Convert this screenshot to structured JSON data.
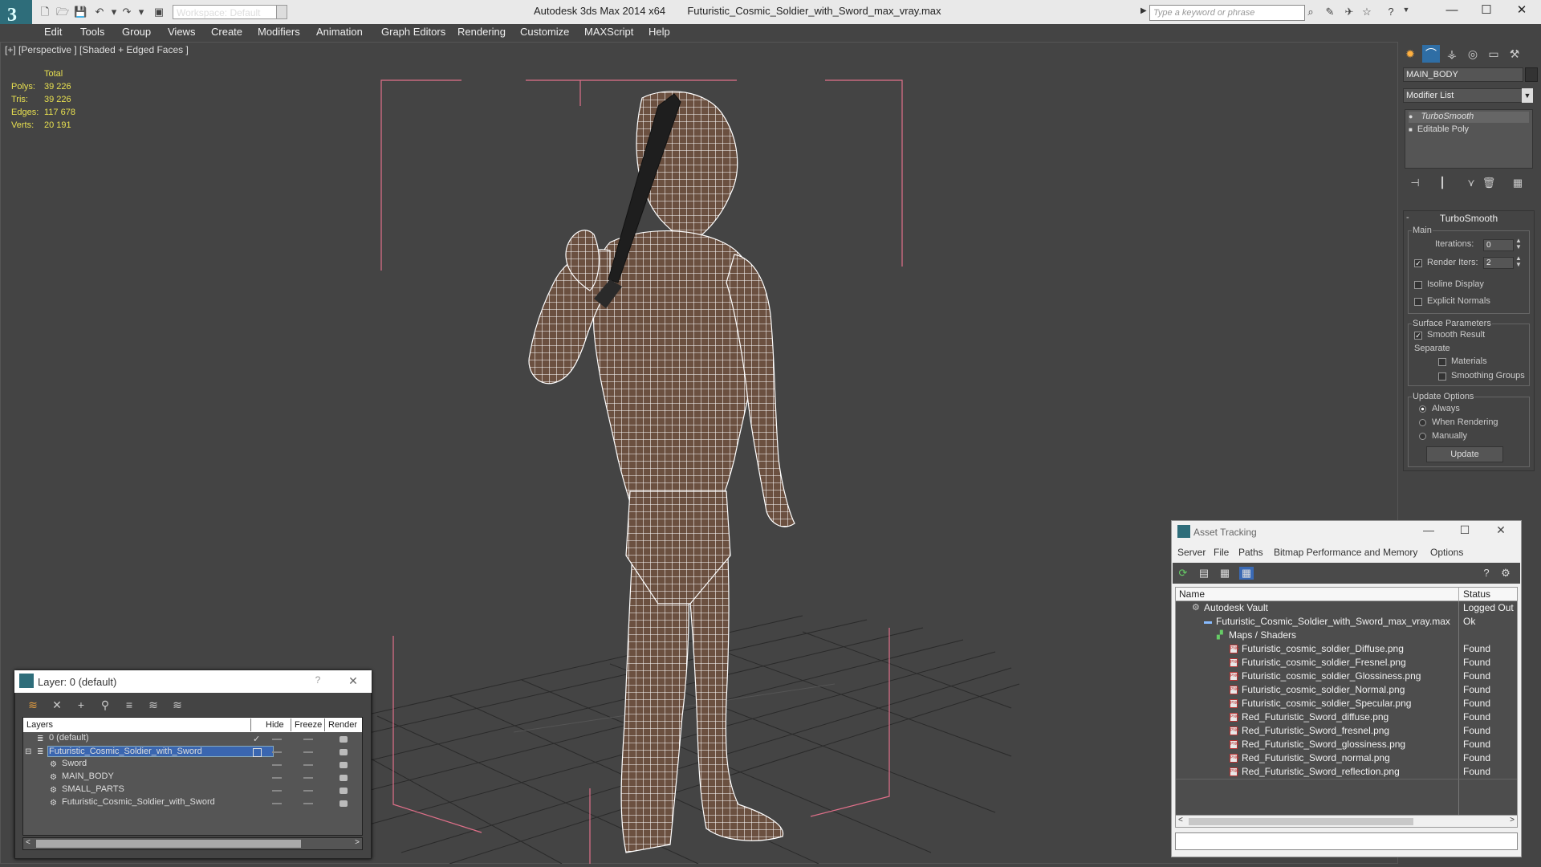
{
  "app": {
    "title_app": "Autodesk 3ds Max 2014 x64",
    "title_file": "Futuristic_Cosmic_Soldier_with_Sword_max_vray.max",
    "workspace": "Workspace: Default",
    "search_placeholder": "Type a keyword or phrase"
  },
  "menu": [
    "Edit",
    "Tools",
    "Group",
    "Views",
    "Create",
    "Modifiers",
    "Animation",
    "Graph Editors",
    "Rendering",
    "Customize",
    "MAXScript",
    "Help"
  ],
  "viewport": {
    "label": "[+] [Perspective ] [Shaded + Edged Faces ]",
    "stats": {
      "total_label": "Total",
      "rows": [
        {
          "label": "Polys:",
          "value": "39 226"
        },
        {
          "label": "Tris:",
          "value": "39 226"
        },
        {
          "label": "Edges:",
          "value": "117 678"
        },
        {
          "label": "Verts:",
          "value": "20 191"
        }
      ]
    }
  },
  "command_panel": {
    "object_name": "MAIN_BODY",
    "modifier_list": "Modifier List",
    "stack": [
      "TurboSmooth",
      "Editable Poly"
    ],
    "rollout_title": "TurboSmooth",
    "main_group": "Main",
    "iterations_label": "Iterations:",
    "iterations_value": "0",
    "render_iters_label": "Render Iters:",
    "render_iters_value": "2",
    "isoline": "Isoline Display",
    "explicit_normals": "Explicit Normals",
    "surface_group": "Surface Parameters",
    "smooth_result": "Smooth Result",
    "separate": "Separate",
    "materials": "Materials",
    "smoothing_groups": "Smoothing Groups",
    "update_group": "Update Options",
    "always": "Always",
    "when_rendering": "When Rendering",
    "manually": "Manually",
    "update_button": "Update"
  },
  "layer_dialog": {
    "title": "Layer: 0 (default)",
    "help": "?",
    "columns": [
      "Layers",
      "Hide",
      "Freeze",
      "Render"
    ],
    "rows": [
      {
        "name": "0 (default)",
        "indent": 0,
        "selected": false,
        "check": true
      },
      {
        "name": "Futuristic_Cosmic_Soldier_with_Sword",
        "indent": 0,
        "selected": true,
        "check": false
      },
      {
        "name": "Sword",
        "indent": 1,
        "selected": false,
        "check": false
      },
      {
        "name": "MAIN_BODY",
        "indent": 1,
        "selected": false,
        "check": false
      },
      {
        "name": "SMALL_PARTS",
        "indent": 1,
        "selected": false,
        "check": false
      },
      {
        "name": "Futuristic_Cosmic_Soldier_with_Sword",
        "indent": 1,
        "selected": false,
        "check": false
      }
    ]
  },
  "asset_tracking": {
    "title": "Asset Tracking",
    "menu": [
      "Server",
      "File",
      "Paths",
      "Bitmap Performance and Memory",
      "Options"
    ],
    "columns": [
      "Name",
      "Status"
    ],
    "rows": [
      {
        "name": "Autodesk Vault",
        "status": "Logged Out",
        "level": 0,
        "icon": "vault"
      },
      {
        "name": "Futuristic_Cosmic_Soldier_with_Sword_max_vray.max",
        "status": "Ok",
        "level": 1,
        "icon": "max"
      },
      {
        "name": "Maps / Shaders",
        "status": "",
        "level": 2,
        "icon": "maps"
      },
      {
        "name": "Futuristic_cosmic_soldier_Diffuse.png",
        "status": "Found",
        "level": 3,
        "icon": "png"
      },
      {
        "name": "Futuristic_cosmic_soldier_Fresnel.png",
        "status": "Found",
        "level": 3,
        "icon": "png"
      },
      {
        "name": "Futuristic_cosmic_soldier_Glossiness.png",
        "status": "Found",
        "level": 3,
        "icon": "png"
      },
      {
        "name": "Futuristic_cosmic_soldier_Normal.png",
        "status": "Found",
        "level": 3,
        "icon": "png"
      },
      {
        "name": "Futuristic_cosmic_soldier_Specular.png",
        "status": "Found",
        "level": 3,
        "icon": "png"
      },
      {
        "name": "Red_Futuristic_Sword_diffuse.png",
        "status": "Found",
        "level": 3,
        "icon": "png"
      },
      {
        "name": "Red_Futuristic_Sword_fresnel.png",
        "status": "Found",
        "level": 3,
        "icon": "png"
      },
      {
        "name": "Red_Futuristic_Sword_glossiness.png",
        "status": "Found",
        "level": 3,
        "icon": "png"
      },
      {
        "name": "Red_Futuristic_Sword_normal.png",
        "status": "Found",
        "level": 3,
        "icon": "png"
      },
      {
        "name": "Red_Futuristic_Sword_reflection.png",
        "status": "Found",
        "level": 3,
        "icon": "png"
      }
    ]
  },
  "colors": {
    "viewport_bg": "#444444",
    "stats_text": "#e8e050",
    "selection": "#3a66b0",
    "bounding_box": "#e0708a",
    "wire": "#ffffff"
  }
}
